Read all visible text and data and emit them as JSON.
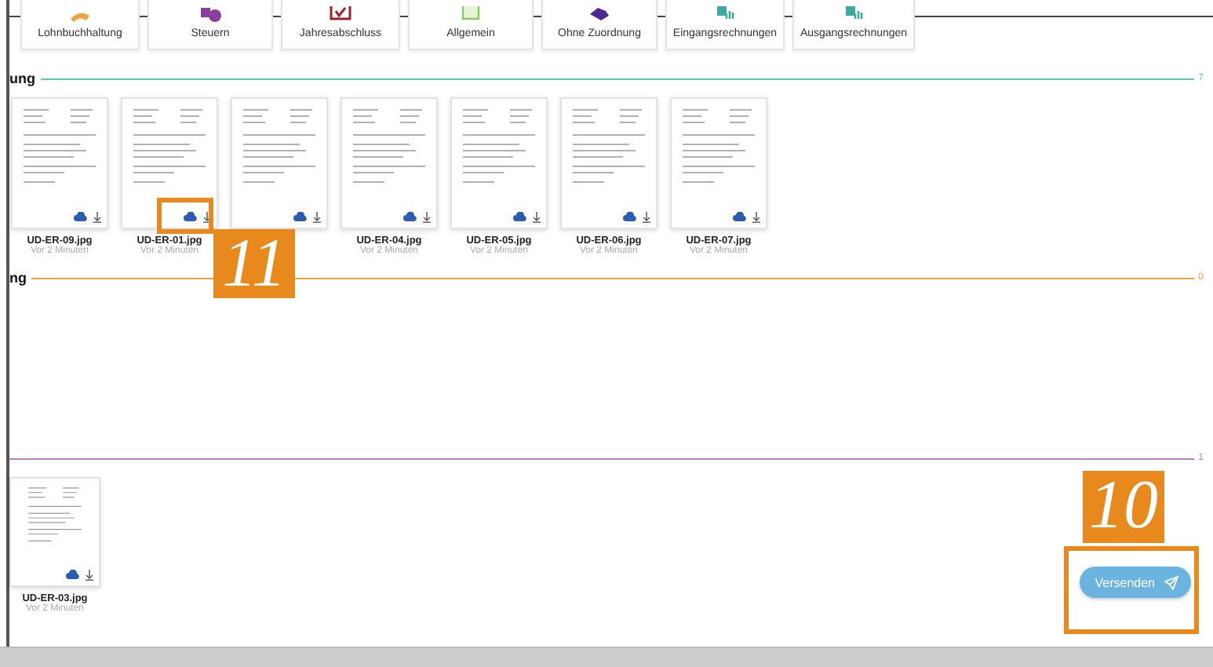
{
  "tabs": [
    {
      "label": "Lohnbuchhaltung"
    },
    {
      "label": "Steuern"
    },
    {
      "label": "Jahresabschluss"
    },
    {
      "label": "Allgemein"
    },
    {
      "label": "Ohne Zuordnung"
    },
    {
      "label": "Eingangsrechnungen"
    },
    {
      "label": "Ausgangsrechnungen"
    }
  ],
  "sections": [
    {
      "title": "ung",
      "count": "7",
      "color": "#5cc8b8",
      "files": [
        {
          "kind": "document",
          "name": "UD-ER-09.jpg",
          "time": "Vor 2 Minuten"
        },
        {
          "kind": "document",
          "name": "UD-ER-01.jpg",
          "time": "Vor 2 Minuten"
        },
        {
          "kind": "document"
        },
        {
          "kind": "document",
          "name": "UD-ER-04.jpg",
          "time": "Vor 2 Minuten"
        },
        {
          "kind": "document",
          "name": "UD-ER-05.jpg",
          "time": "Vor 2 Minuten"
        },
        {
          "kind": "document",
          "name": "UD-ER-06.jpg",
          "time": "Vor 2 Minuten"
        },
        {
          "kind": "document",
          "name": "UD-ER-07.jpg",
          "time": "Vor 2 Minuten"
        }
      ]
    },
    {
      "title": "ng",
      "count": "0",
      "color": "#f0a040"
    },
    {
      "count": "1",
      "color": "#c080c0",
      "files": [
        {
          "kind": "document",
          "name": "UD-ER-03.jpg",
          "time": "Vor 2 Minuten"
        }
      ]
    }
  ],
  "send_button": {
    "label": "Versenden"
  },
  "callouts": [
    {
      "number": "11"
    },
    {
      "number": "10"
    }
  ]
}
